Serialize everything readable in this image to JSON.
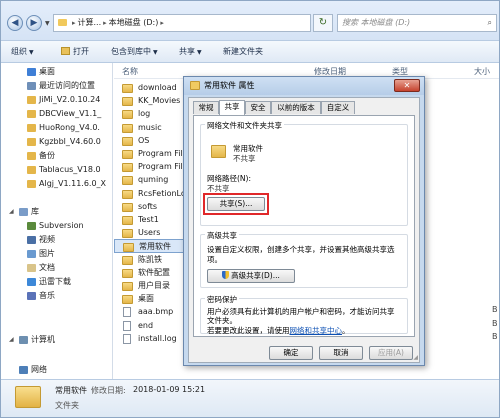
{
  "address": {
    "crumbs": [
      "计算...",
      "本地磁盘 (D:)"
    ],
    "search_placeholder": "搜索 本地磁盘 (D:)"
  },
  "toolbar": {
    "organize": "组织",
    "open": "打开",
    "include_in_library": "包含到库中",
    "share": "共享",
    "new_folder": "新建文件夹"
  },
  "nav": {
    "desktop": "桌面",
    "recent": "最近访问的位置",
    "items": [
      "JiMi_V2.0.10.24",
      "DBCView_V1.1_",
      "HuoRong_V4.0.",
      "Kgzbbl_V4.60.0",
      "备份",
      "Tablacus_V18.0",
      "Algj_V1.11.6.0_X"
    ],
    "library": "库",
    "libs": [
      "Subversion",
      "视频",
      "图片",
      "文档",
      "迅雷下载",
      "音乐"
    ],
    "computer": "计算机",
    "network": "网络"
  },
  "list": {
    "col_name": "名称",
    "col_date": "修改日期",
    "col_type": "类型",
    "col_size": "大小",
    "files": [
      {
        "name": "download",
        "kind": "folder"
      },
      {
        "name": "KK_Movies",
        "kind": "folder"
      },
      {
        "name": "log",
        "kind": "folder"
      },
      {
        "name": "music",
        "kind": "folder"
      },
      {
        "name": "OS",
        "kind": "folder"
      },
      {
        "name": "Program Files",
        "kind": "folder"
      },
      {
        "name": "Program Files",
        "kind": "folder"
      },
      {
        "name": "quming",
        "kind": "folder"
      },
      {
        "name": "RcsFetionLog",
        "kind": "folder"
      },
      {
        "name": "softs",
        "kind": "folder"
      },
      {
        "name": "Test1",
        "kind": "folder"
      },
      {
        "name": "Users",
        "kind": "folder"
      },
      {
        "name": "常用软件",
        "kind": "folder",
        "selected": true
      },
      {
        "name": "陈凯铁",
        "kind": "folder"
      },
      {
        "name": "软件配置",
        "kind": "folder"
      },
      {
        "name": "用户目录",
        "kind": "folder"
      },
      {
        "name": "桌面",
        "kind": "folder"
      },
      {
        "name": "aaa.bmp",
        "kind": "file"
      },
      {
        "name": "end",
        "kind": "file"
      },
      {
        "name": "install.log",
        "kind": "file"
      }
    ],
    "right_values": [
      {
        "row": 17,
        "text": "B"
      },
      {
        "row": 18,
        "text": "B"
      },
      {
        "row": 19,
        "text": "B"
      }
    ]
  },
  "status": {
    "name": "常用软件",
    "date_label": "修改日期:",
    "date": "2018-01-09 15:21",
    "type": "文件夹"
  },
  "dialog": {
    "title": "常用软件 属性",
    "close": "✕",
    "tabs": [
      "常规",
      "共享",
      "安全",
      "以前的版本",
      "自定义"
    ],
    "active_tab": "共享",
    "group1_title": "网络文件和文件夹共享",
    "share_name": "常用软件",
    "share_state": "不共享",
    "network_path_label": "网络路径(N):",
    "network_path_value": "不共享",
    "share_button": "共享(S)...",
    "group2_title": "高级共享",
    "adv_desc_1": "设置自定义权限，创建多个共享，并设置其他高级共享选",
    "adv_desc_2": "项。",
    "adv_button": "高级共享(D)...",
    "group3_title": "密码保护",
    "pwd_desc_1": "用户必须具有此计算机的用户帐户和密码，才能访问共享",
    "pwd_desc_2": "文件夹。",
    "pwd_change_prefix": "若要更改此设置，请使用",
    "pwd_change_link": "网络和共享中心",
    "pwd_change_suffix": "。",
    "ok": "确定",
    "cancel": "取消",
    "apply": "应用(A)"
  },
  "colors": {
    "accent_red": "#e0282a",
    "link_blue": "#0b4fb3",
    "folder_yellow": "#e4b64a"
  }
}
